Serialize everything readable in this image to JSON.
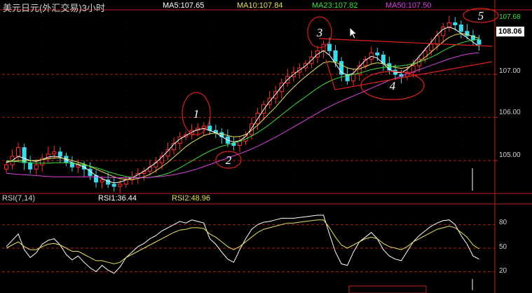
{
  "header": {
    "title": "美元日元(外汇交易)3小时",
    "ma5": "MA5:107.65",
    "ma10": "MA10:107.84",
    "ma23": "MA23:107.82",
    "ma50": "MA50:107.50"
  },
  "price_axis": {
    "ticks": [
      "107.00",
      "106.00",
      "105.00"
    ],
    "current_price": "108.06",
    "ma23_tag": "107.68"
  },
  "rsi_header": {
    "title": "RSI(7,14)",
    "rsi1": "RSI1:36.44",
    "rsi2": "RSI2:48.96"
  },
  "rsi_axis": {
    "ticks": [
      "80",
      "50",
      "20"
    ]
  },
  "annotations": [
    "1",
    "2",
    "3",
    "4",
    "5"
  ],
  "colors": {
    "bg": "#000000",
    "up": "#ff3030",
    "down": "#40d8e8",
    "ma5": "#ffffff",
    "ma10": "#e8e060",
    "ma23": "#40e040",
    "ma50": "#e040e0",
    "grid": "#aa2020",
    "rsi1": "#ffffff",
    "rsi2": "#e8e060"
  },
  "chart_data": {
    "type": "candlestick",
    "ylim": [
      104.3,
      108.5
    ],
    "closes": [
      104.9,
      105.1,
      105.3,
      104.95,
      104.8,
      104.9,
      105.05,
      105.15,
      105.2,
      105.1,
      104.95,
      104.85,
      104.9,
      104.8,
      104.65,
      104.5,
      104.55,
      104.45,
      104.4,
      104.45,
      104.55,
      104.6,
      104.7,
      104.75,
      104.85,
      104.95,
      105.1,
      105.25,
      105.4,
      105.55,
      105.6,
      105.7,
      105.75,
      105.8,
      105.7,
      105.65,
      105.55,
      105.4,
      105.35,
      105.45,
      105.6,
      105.85,
      106.1,
      106.3,
      106.45,
      106.6,
      106.8,
      106.95,
      107.05,
      107.15,
      107.25,
      107.4,
      107.55,
      107.7,
      107.55,
      107.3,
      107.0,
      106.85,
      107.0,
      107.2,
      107.35,
      107.5,
      107.45,
      107.25,
      107.1,
      107.0,
      106.95,
      107.05,
      107.2,
      107.35,
      107.55,
      107.7,
      107.9,
      108.1,
      108.2,
      108.15,
      108.0,
      107.9,
      107.8,
      107.7
    ],
    "series": [
      {
        "name": "MA5",
        "values": [
          104.95,
          105.0,
          105.1,
          105.05,
          105.0,
          104.98,
          105.02,
          105.08,
          105.1,
          105.08,
          105.02,
          104.95,
          104.9,
          104.85,
          104.75,
          104.65,
          104.58,
          104.52,
          104.48,
          104.5,
          104.55,
          104.6,
          104.67,
          104.75,
          104.85,
          104.95,
          105.08,
          105.22,
          105.38,
          105.5,
          105.58,
          105.66,
          105.72,
          105.74,
          105.7,
          105.64,
          105.56,
          105.47,
          105.43,
          105.46,
          105.56,
          105.75,
          105.97,
          106.18,
          106.37,
          106.54,
          106.72,
          106.88,
          107.0,
          107.1,
          107.2,
          107.33,
          107.47,
          107.55,
          107.45,
          107.25,
          107.05,
          106.98,
          107.03,
          107.18,
          107.33,
          107.42,
          107.38,
          107.25,
          107.12,
          107.05,
          107.04,
          107.12,
          107.26,
          107.42,
          107.58,
          107.75,
          107.92,
          108.05,
          108.1,
          108.05,
          107.95,
          107.85,
          107.75,
          107.65
        ]
      },
      {
        "name": "MA10",
        "values": [
          104.98,
          104.98,
          105.0,
          105.0,
          105.0,
          105.0,
          105.02,
          105.04,
          105.06,
          105.06,
          105.04,
          105.0,
          104.96,
          104.92,
          104.86,
          104.8,
          104.74,
          104.68,
          104.62,
          104.58,
          104.56,
          104.56,
          104.58,
          104.62,
          104.68,
          104.76,
          104.86,
          104.96,
          105.08,
          105.2,
          105.32,
          105.42,
          105.5,
          105.58,
          105.62,
          105.64,
          105.62,
          105.58,
          105.55,
          105.56,
          105.6,
          105.7,
          105.82,
          105.96,
          106.1,
          106.24,
          106.4,
          106.56,
          106.7,
          106.83,
          106.95,
          107.06,
          107.17,
          107.27,
          107.3,
          107.28,
          107.22,
          107.15,
          107.12,
          107.13,
          107.18,
          107.24,
          107.27,
          107.25,
          107.2,
          107.16,
          107.14,
          107.16,
          107.22,
          107.3,
          107.4,
          107.52,
          107.64,
          107.76,
          107.86,
          107.92,
          107.95,
          107.93,
          107.88,
          107.84
        ]
      },
      {
        "name": "MA23",
        "values": [
          105.0,
          104.98,
          104.97,
          104.96,
          104.95,
          104.94,
          104.94,
          104.94,
          104.95,
          104.95,
          104.95,
          104.94,
          104.92,
          104.9,
          104.87,
          104.83,
          104.79,
          104.74,
          104.7,
          104.66,
          104.63,
          104.61,
          104.6,
          104.6,
          104.61,
          104.63,
          104.66,
          104.7,
          104.76,
          104.83,
          104.91,
          104.99,
          105.07,
          105.15,
          105.22,
          105.28,
          105.33,
          105.37,
          105.41,
          105.45,
          105.5,
          105.57,
          105.65,
          105.74,
          105.84,
          105.95,
          106.06,
          106.17,
          106.28,
          106.38,
          106.48,
          106.58,
          106.68,
          106.77,
          106.84,
          106.9,
          106.94,
          106.97,
          107.0,
          107.03,
          107.07,
          107.11,
          107.14,
          107.16,
          107.18,
          107.19,
          107.2,
          107.22,
          107.25,
          107.29,
          107.34,
          107.4,
          107.47,
          107.55,
          107.62,
          107.68,
          107.73,
          107.77,
          107.8,
          107.82
        ]
      },
      {
        "name": "MA50",
        "values": [
          104.7,
          104.69,
          104.68,
          104.67,
          104.66,
          104.65,
          104.64,
          104.63,
          104.62,
          104.62,
          104.62,
          104.62,
          104.62,
          104.62,
          104.62,
          104.62,
          104.61,
          104.61,
          104.6,
          104.6,
          104.6,
          104.6,
          104.6,
          104.6,
          104.61,
          104.62,
          104.63,
          104.65,
          104.67,
          104.7,
          104.73,
          104.77,
          104.81,
          104.86,
          104.91,
          104.96,
          105.01,
          105.06,
          105.11,
          105.16,
          105.21,
          105.27,
          105.33,
          105.4,
          105.47,
          105.54,
          105.62,
          105.7,
          105.78,
          105.86,
          105.94,
          106.02,
          106.1,
          106.18,
          106.25,
          106.32,
          106.38,
          106.44,
          106.5,
          106.56,
          106.62,
          106.68,
          106.74,
          106.8,
          106.86,
          106.91,
          106.96,
          107.01,
          107.06,
          107.11,
          107.16,
          107.21,
          107.26,
          107.31,
          107.36,
          107.4,
          107.44,
          107.47,
          107.49,
          107.5
        ]
      }
    ],
    "rsi": {
      "ylim": [
        0,
        100
      ],
      "series": [
        {
          "name": "RSI1",
          "values": [
            52,
            60,
            68,
            48,
            38,
            44,
            55,
            60,
            62,
            54,
            42,
            35,
            40,
            32,
            25,
            20,
            28,
            22,
            18,
            26,
            38,
            45,
            52,
            56,
            62,
            66,
            72,
            76,
            80,
            84,
            82,
            86,
            84,
            82,
            62,
            55,
            45,
            36,
            32,
            48,
            62,
            74,
            80,
            83,
            84,
            86,
            88,
            88,
            88,
            89,
            90,
            91,
            92,
            92,
            68,
            45,
            30,
            28,
            45,
            58,
            64,
            70,
            62,
            48,
            40,
            36,
            34,
            46,
            58,
            66,
            72,
            78,
            82,
            85,
            86,
            80,
            66,
            55,
            40,
            36
          ]
        },
        {
          "name": "RSI2",
          "values": [
            50,
            54,
            58,
            52,
            48,
            48,
            52,
            55,
            56,
            54,
            50,
            46,
            46,
            42,
            38,
            34,
            34,
            32,
            30,
            32,
            38,
            42,
            46,
            50,
            54,
            58,
            62,
            66,
            70,
            73,
            74,
            76,
            76,
            75,
            68,
            64,
            58,
            52,
            48,
            52,
            58,
            64,
            70,
            74,
            76,
            78,
            80,
            82,
            82,
            83,
            84,
            85,
            86,
            86,
            76,
            64,
            54,
            50,
            54,
            58,
            62,
            64,
            62,
            56,
            52,
            50,
            48,
            52,
            58,
            62,
            66,
            70,
            74,
            76,
            78,
            76,
            70,
            64,
            54,
            49
          ]
        }
      ]
    }
  }
}
